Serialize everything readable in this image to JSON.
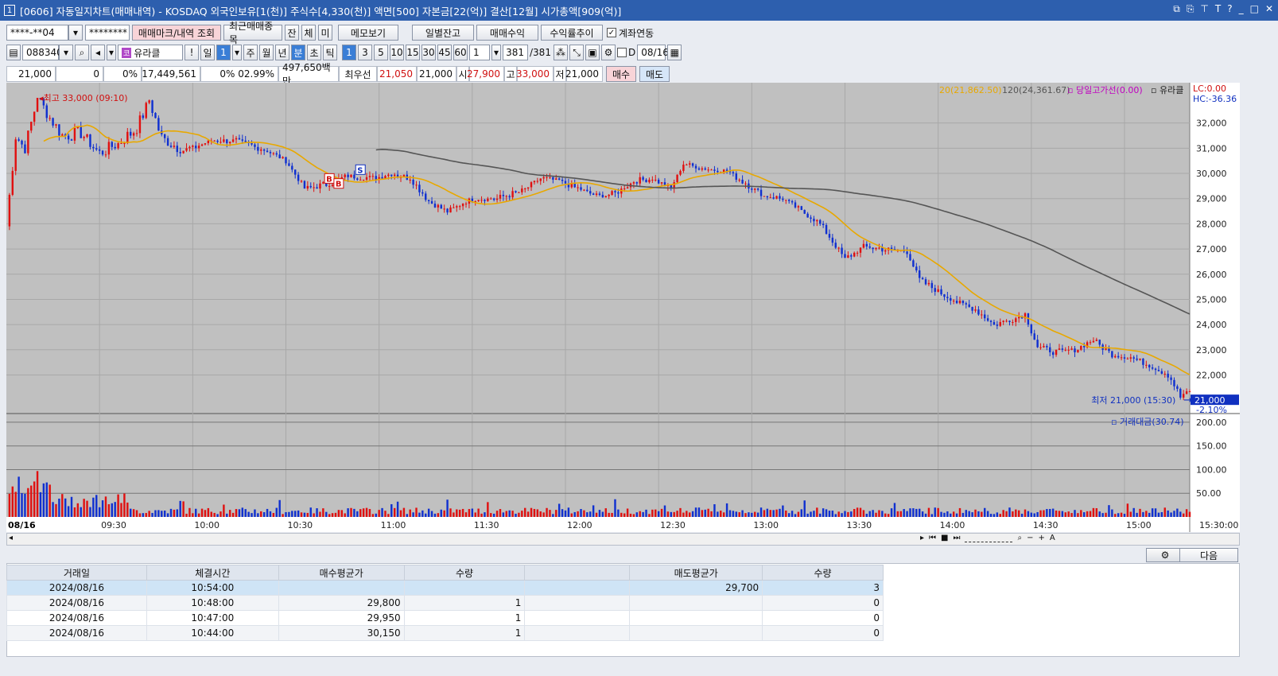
{
  "window": {
    "number": "1",
    "title": "[0606] 자동일지차트(매매내역) - KOSDAQ 외국인보유[1(천)] 주식수[4,330(천)] 액면[500] 자본금[22(억)] 결산[12월] 시가총액[909(억)]"
  },
  "toolbar1": {
    "account": "****-**04",
    "password": "********",
    "mark_btn": "매매마크/내역 조회",
    "recent_btn": "최근매매종목",
    "jan": "잔",
    "che": "체",
    "mi": "미",
    "memo_btn": "메모보기",
    "daily_btn": "일별잔고",
    "profit_btn": "매매수익",
    "trend_btn": "수익률추이",
    "link_label": "계좌연동"
  },
  "toolbar2": {
    "code": "088340",
    "name": "유라클",
    "period_day": "일",
    "period_day_val": "1",
    "week": "주",
    "month": "월",
    "year": "년",
    "minute": "분",
    "second": "초",
    "tick": "틱",
    "intervals": [
      "1",
      "3",
      "5",
      "10",
      "15",
      "30",
      "45",
      "60"
    ],
    "interval_select": "1",
    "count": "381",
    "count_total": "/381",
    "d_label": "D",
    "date": "08/16"
  },
  "info": {
    "price": "21,000",
    "change": "0",
    "change_pct": "0%",
    "volume": "17,449,561",
    "vol_pct": "0% 02.99%",
    "amount": "497,650백만",
    "best_label": "최우선",
    "best_sell": "21,050",
    "best_buy": "21,000",
    "open_label": "시",
    "open": "27,900",
    "high_label": "고",
    "high": "33,000",
    "low_label": "저",
    "low": "21,000",
    "buy_btn": "매수",
    "sell_btn": "매도"
  },
  "chart_labels": {
    "ma20": "20(21,862.50)",
    "ma120": "120(24,361.67)",
    "day_high_line": "당일고가선(0.00)",
    "name": "유라클",
    "lc": "LC:0.00",
    "hc": "HC:-36.36",
    "high_marker": "최고 33,000 (09:10)",
    "low_marker": "최저 21,000 (15:30)",
    "last_price": "21,000",
    "last_pct": "-2.10%",
    "vol_label": "거래대금(30.74)",
    "date_label": "08/16",
    "end_time": "15:30:00"
  },
  "colors": {
    "up": "#e01010",
    "down": "#1030d0",
    "ma20": "#e8a800",
    "ma120": "#555555",
    "chart_bg": "#c0c0c0"
  },
  "chart_data": {
    "type": "candlestick",
    "price_ticks": [
      "32,000",
      "31,000",
      "30,000",
      "29,000",
      "28,000",
      "27,000",
      "26,000",
      "25,000",
      "24,000",
      "23,000",
      "22,000"
    ],
    "price_values": [
      32000,
      31000,
      30000,
      29000,
      28000,
      27000,
      26000,
      25000,
      24000,
      23000,
      22000
    ],
    "ylim": [
      20500,
      33600
    ],
    "volume_ticks": [
      "200.00",
      "150.00",
      "100.00",
      "50.00"
    ],
    "volume_values": [
      200,
      150,
      100,
      50
    ],
    "volume_ylim": [
      0,
      215
    ],
    "time_labels": [
      "09:30",
      "10:00",
      "10:30",
      "11:00",
      "11:30",
      "12:00",
      "12:30",
      "13:00",
      "13:30",
      "14:00",
      "14:30",
      "15:00"
    ],
    "time_minutes": [
      30,
      60,
      90,
      120,
      150,
      180,
      210,
      240,
      270,
      300,
      330,
      360
    ],
    "x_range_minutes": [
      0,
      381
    ],
    "anchors": [
      [
        0,
        27900
      ],
      [
        3,
        31500
      ],
      [
        6,
        31000
      ],
      [
        10,
        33000
      ],
      [
        14,
        32200
      ],
      [
        18,
        31500
      ],
      [
        24,
        31600
      ],
      [
        30,
        30800
      ],
      [
        36,
        31200
      ],
      [
        42,
        31800
      ],
      [
        46,
        32900
      ],
      [
        50,
        31400
      ],
      [
        58,
        30900
      ],
      [
        66,
        31300
      ],
      [
        74,
        31300
      ],
      [
        84,
        30900
      ],
      [
        90,
        30500
      ],
      [
        96,
        29400
      ],
      [
        104,
        29600
      ],
      [
        110,
        29900
      ],
      [
        118,
        29800
      ],
      [
        124,
        30000
      ],
      [
        130,
        29800
      ],
      [
        136,
        28900
      ],
      [
        142,
        28500
      ],
      [
        150,
        29000
      ],
      [
        158,
        29000
      ],
      [
        166,
        29300
      ],
      [
        172,
        29800
      ],
      [
        178,
        29700
      ],
      [
        184,
        29400
      ],
      [
        190,
        29100
      ],
      [
        196,
        29200
      ],
      [
        202,
        29700
      ],
      [
        208,
        29800
      ],
      [
        214,
        29400
      ],
      [
        218,
        30400
      ],
      [
        224,
        30200
      ],
      [
        232,
        30100
      ],
      [
        238,
        29600
      ],
      [
        244,
        29100
      ],
      [
        250,
        29000
      ],
      [
        256,
        28500
      ],
      [
        262,
        28000
      ],
      [
        266,
        27300
      ],
      [
        270,
        26600
      ],
      [
        276,
        27100
      ],
      [
        282,
        27000
      ],
      [
        290,
        26900
      ],
      [
        294,
        25800
      ],
      [
        300,
        25300
      ],
      [
        306,
        24900
      ],
      [
        312,
        24600
      ],
      [
        318,
        24000
      ],
      [
        324,
        24200
      ],
      [
        328,
        24400
      ],
      [
        332,
        23100
      ],
      [
        338,
        22900
      ],
      [
        344,
        23000
      ],
      [
        350,
        23400
      ],
      [
        356,
        22800
      ],
      [
        362,
        22700
      ],
      [
        368,
        22400
      ],
      [
        374,
        22000
      ],
      [
        378,
        21200
      ],
      [
        381,
        21300
      ]
    ],
    "high_point": {
      "minute": 10,
      "price": 33000
    },
    "low_point": {
      "minute": 378,
      "price": 21000
    },
    "trade_marks": [
      {
        "type": "B",
        "minute": 104,
        "price": 29800
      },
      {
        "type": "B",
        "minute": 107,
        "price": 29600
      },
      {
        "type": "S",
        "minute": 114,
        "price": 30150
      }
    ]
  },
  "controls": {
    "next_btn": "다음"
  },
  "table": {
    "headers": [
      "거래일",
      "체결시간",
      "매수평균가",
      "수량",
      "",
      "매도평균가",
      "수량"
    ],
    "rows": [
      [
        "2024/08/16",
        "10:54:00",
        "",
        "",
        "",
        "29,700",
        "3"
      ],
      [
        "2024/08/16",
        "10:48:00",
        "29,800",
        "1",
        "",
        "",
        "0"
      ],
      [
        "2024/08/16",
        "10:47:00",
        "29,950",
        "1",
        "",
        "",
        "0"
      ],
      [
        "2024/08/16",
        "10:44:00",
        "30,150",
        "1",
        "",
        "",
        "0"
      ]
    ]
  }
}
